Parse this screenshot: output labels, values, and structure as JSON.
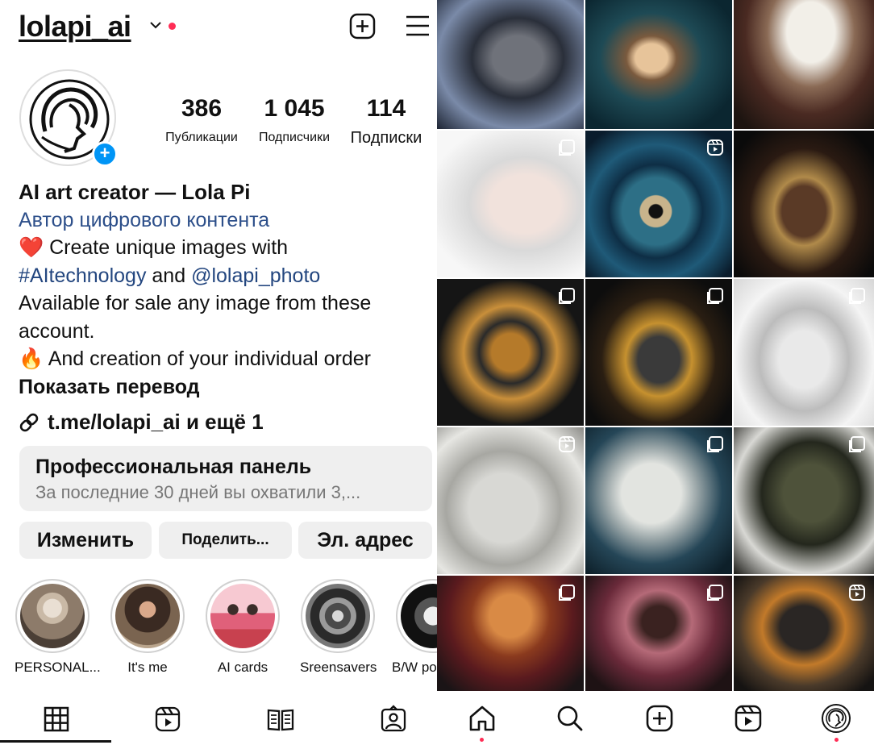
{
  "profile": {
    "username": "lolapi_ai",
    "stats": [
      {
        "value": "386",
        "label": "Публикации"
      },
      {
        "value": "1 045",
        "label": "Подписчики"
      },
      {
        "value": "114",
        "label": "Подписки"
      }
    ],
    "bio": {
      "name": "AI art creator — Lola Pi",
      "category": "Автор цифрового контента",
      "line1_emoji": "❤️",
      "line1_text": "Create unique images with",
      "hashtag": "#AItechnology",
      "and": "and",
      "mention": "@lolapi_photo",
      "line3": "Available for sale any image from these",
      "line4": "account.",
      "line5_emoji": "🔥",
      "line5_text": "And creation of your individual order",
      "show_translation": "Показать перевод"
    },
    "external_link": "t.me/lolapi_ai и ещё 1"
  },
  "pro_panel": {
    "title": "Профессиональная панель",
    "subtitle": "За последние 30 дней вы охватили 3,..."
  },
  "buttons": {
    "edit": "Изменить",
    "share": "Поделить...",
    "email": "Эл. адрес"
  },
  "highlights": [
    {
      "label": "PERSONAL..."
    },
    {
      "label": "It's me"
    },
    {
      "label": "AI cards"
    },
    {
      "label": "Sreensavers"
    },
    {
      "label": "B/W po"
    }
  ],
  "profile_tabs": [
    "grid-tab",
    "reels-tab",
    "guides-tab",
    "tagged-tab"
  ],
  "bottom_nav": [
    "home",
    "search",
    "create",
    "reels",
    "profile"
  ],
  "colors": {
    "accent_blue": "#0095f6",
    "link_blue": "#23467f",
    "notification_red": "#ff2d55",
    "panel_gray": "#efefef"
  }
}
